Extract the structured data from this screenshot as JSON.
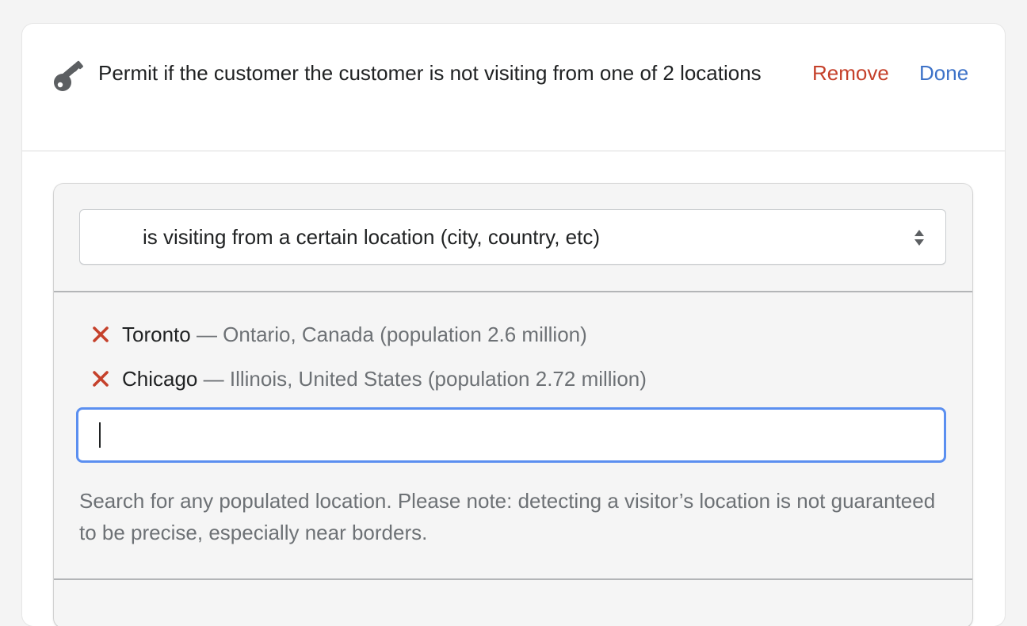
{
  "header": {
    "title": "Permit if the customer the customer is not visiting from one of 2 locations",
    "icon": "key-icon",
    "remove_label": "Remove",
    "done_label": "Done"
  },
  "condition": {
    "selected": "is visiting from a certain location (city, country, etc)"
  },
  "locations": [
    {
      "name": "Toronto",
      "detail": " — Ontario, Canada (population 2.6 million)"
    },
    {
      "name": "Chicago",
      "detail": " — Illinois, United States (population 2.72 million)"
    }
  ],
  "search": {
    "value": "",
    "placeholder": ""
  },
  "help_text": "Search for any populated location. Please note: detecting a visitor’s location is not guaranteed to be precise, especially near borders.",
  "colors": {
    "remove": "#c5412b",
    "done": "#3d72c8",
    "focus": "#5b8ff0",
    "muted": "#6d7175"
  }
}
